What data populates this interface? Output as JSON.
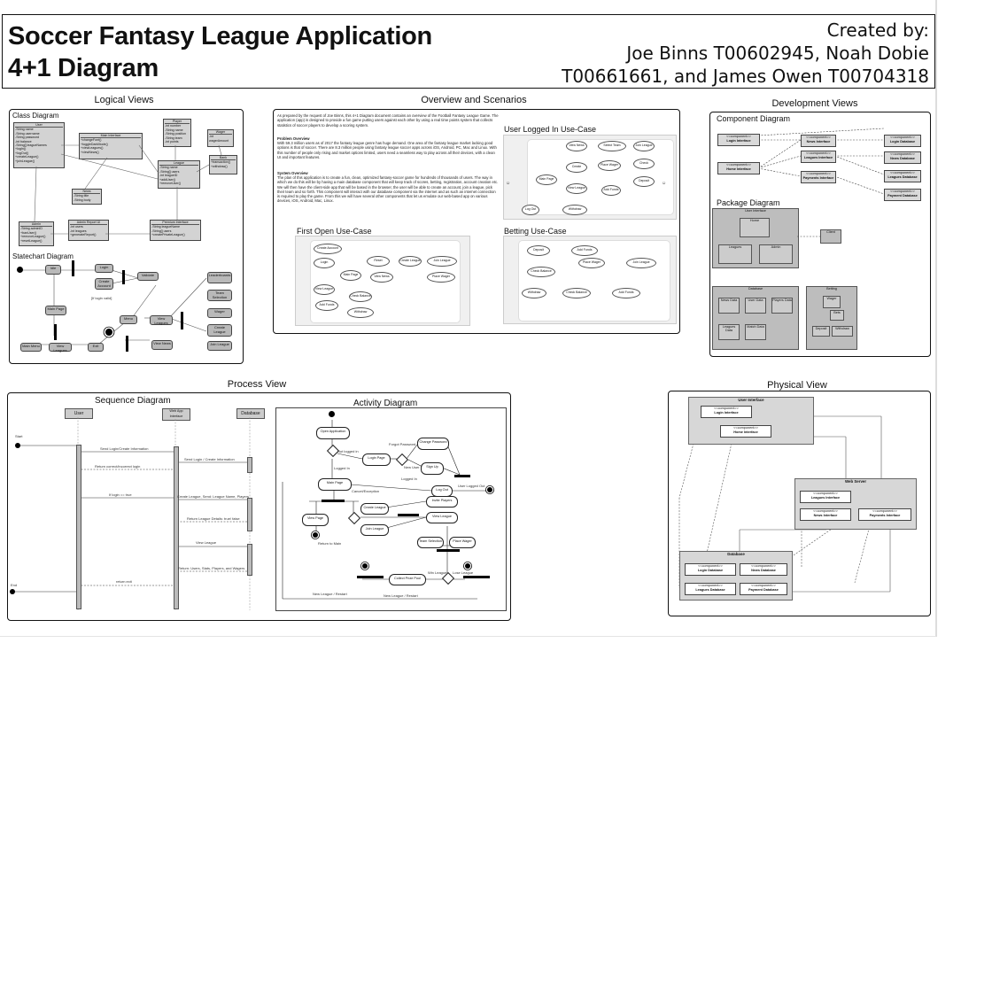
{
  "header": {
    "title_line1": "Soccer Fantasy League Application",
    "title_line2": "4+1 Diagram",
    "credit_line1": "Created by:",
    "credit_line2": "Joe Binns T00602945, Noah Dobie",
    "credit_line3": "T00661661, and James Owen T00704318"
  },
  "sections": {
    "logical": "Logical Views",
    "overview": "Overview and Scenarios",
    "development": "Development Views",
    "process": "Process View",
    "physical": "Physical View"
  },
  "subtitles": {
    "class_diagram": "Class Diagram",
    "statechart": "Statechart Diagram",
    "user_logged_in": "User Logged In Use-Case",
    "first_open": "First Open Use-Case",
    "betting": "Betting Use-Case",
    "component": "Component Diagram",
    "package": "Package Diagram",
    "sequence": "Sequence Diagram",
    "activity": "Activity Diagram"
  },
  "overview_text": {
    "intro": "As prepared by the request of Joe Binns, this 4+1 Diagram document contains an overview of the Football Fantasy League Game. The application (app) is designed to provide a fun game putting users against each other by using a real time points system that collects statistics of soccer players to develop a scoring system.",
    "problem_heading": "Problem Overview",
    "problem": "With 59.3 million users as of 2017 the fantasy league genre has huge demand. One area of the fantasy league market lacking good options is that of soccer. There are 8.3 million people using fantasy league soccer apps across iOS, Android, PC, Mac and Linux. With this number of people only rising and market options limited, users need a seamless way to play across all their devices, with a clean UI and important features.",
    "system_heading": "System Overview",
    "system": "The plan of this application is to create a fun, clean, optimized fantasy-soccer game for hundreds of thousands of users. The way in which we do this will be by having a main database component that will keep track of scores, betting, registration, account creation etc. We will then have the client-side app that will be based in the browser, the user will be able to create an account, join a league, pick their team and so forth. This component will interact with our database component via the internet and as such an internet connection is required to play the game. From this we will have several other components that let us emulate our web-based app on various devices, iOS, Android, Mac, Linux."
  },
  "class_diagram": {
    "classes": [
      {
        "name": "User",
        "lines": [
          "-String name",
          "-String username",
          "-String password",
          "-int balance",
          "-String[] leagueNames",
          "+logIn()",
          "+logOut()",
          "+createLeague()",
          "+joinLeague()"
        ]
      },
      {
        "name": "Main Interface",
        "lines": [
          "+changeFont()",
          "+toggleDarkMode()",
          "+viewLeagues()",
          "+viewNews()"
        ]
      },
      {
        "name": "Player",
        "lines": [
          "-int number",
          "-String name",
          "-String position",
          "-String team",
          "-int points"
        ]
      },
      {
        "name": "Wager",
        "lines": [
          "-int wagerAmount"
        ]
      },
      {
        "name": "Bank",
        "lines": [
          "+transaction()",
          "+withdraw()"
        ]
      },
      {
        "name": "League",
        "lines": [
          "-String name",
          "-String[] users",
          "-int leagueID",
          "+addUser()",
          "+removeUser()"
        ]
      },
      {
        "name": "News",
        "lines": [
          "-String title",
          "-String body"
        ]
      },
      {
        "name": "Admin",
        "lines": [
          "-String adminID",
          "+banUser()",
          "+removeLeague()",
          "+resetLeague()"
        ]
      },
      {
        "name": "Admin Report UI",
        "lines": [
          "-int users",
          "-int leagues",
          "+generateReport()"
        ]
      },
      {
        "name": "Premium Interface",
        "lines": [
          "-String leagueName",
          "-String[] users",
          "+createPrivateLeague()"
        ]
      }
    ]
  },
  "statechart": {
    "states": [
      "Idle",
      "Login",
      "Create Account",
      "Validate",
      "Main Page",
      "Menu",
      "View Leagues",
      "Leaderboards",
      "Team Selection",
      "Wager",
      "Create League",
      "Join League",
      "View News",
      "Error",
      "Main Menu",
      "View Leagues",
      "Exit",
      "Start"
    ],
    "guards": [
      "[If login valid]"
    ]
  },
  "use_case_labels": {
    "user": "User",
    "database": "Database",
    "main_page": "Main Page",
    "create_league": "Create League",
    "join_league": "Join League",
    "view_news": "View News",
    "select_team": "Select Team Selection",
    "place_wager": "Place Wager",
    "logout": "Log Out",
    "login": "Login",
    "create_account": "Create Account",
    "reset_password": "Reset Password",
    "check_balance": "Check Balance",
    "add_funds": "Add Funds",
    "withdraw": "Withdraw",
    "view_league": "View League",
    "deposit": "Deposit"
  },
  "component_diagram": {
    "stereotype": "<<component>>",
    "components": [
      "Login Interface",
      "Home Interface",
      "News Interface",
      "Leagues Interface",
      "Payments Interface",
      "Login Database",
      "News Database",
      "Leagues Database",
      "Payment Database"
    ]
  },
  "package_diagram": {
    "packages": [
      "User Interface",
      "Home",
      "Leagues",
      "Admin",
      "Client",
      "Database",
      "News Data",
      "User Data",
      "Players Data",
      "Leagues Data",
      "Match Data",
      "Betting",
      "Wager",
      "Bets",
      "Deposit",
      "Withdraw"
    ]
  },
  "sequence_diagram": {
    "lifelines": [
      "User",
      "Web App Interface",
      "Database"
    ],
    "start": "Start",
    "end": "End",
    "messages": [
      "Send Login/Create Information",
      "Send Login / Create Information",
      "Return correct/incorrect login",
      "If login == true",
      "Create League, Send: League Name, Players",
      "Return League Details: true/ false",
      "View League",
      "Return: Users, Stats, Players, and Wagers",
      "return exit"
    ]
  },
  "activity_diagram": {
    "nodes": [
      "Open Application",
      "Login Page",
      "Change Password",
      "Sign Up",
      "Main Page",
      "Log Out",
      "View Page",
      "Create League",
      "Invite Players",
      "Join League",
      "View League",
      "Team Selection",
      "Place Wager",
      "Collect Prize Pool"
    ],
    "guards": [
      "Not logged in",
      "Forgot Password",
      "New User",
      "Logged In",
      "Logged In",
      "Cancel/Exception",
      "User Logged Out",
      "Return to Main",
      "Win League",
      "Lose League",
      "New League / Restart",
      "New League / Restart"
    ]
  },
  "physical_view": {
    "stereotype": "<<component>>",
    "nodes": [
      "User Interface",
      "Web Server",
      "Database"
    ],
    "components": [
      "Login Interface",
      "Home Interface",
      "Leagues Interface",
      "News Interface",
      "Payments Interface",
      "Login Database",
      "News Database",
      "Leagues Database",
      "Payment Database"
    ]
  }
}
